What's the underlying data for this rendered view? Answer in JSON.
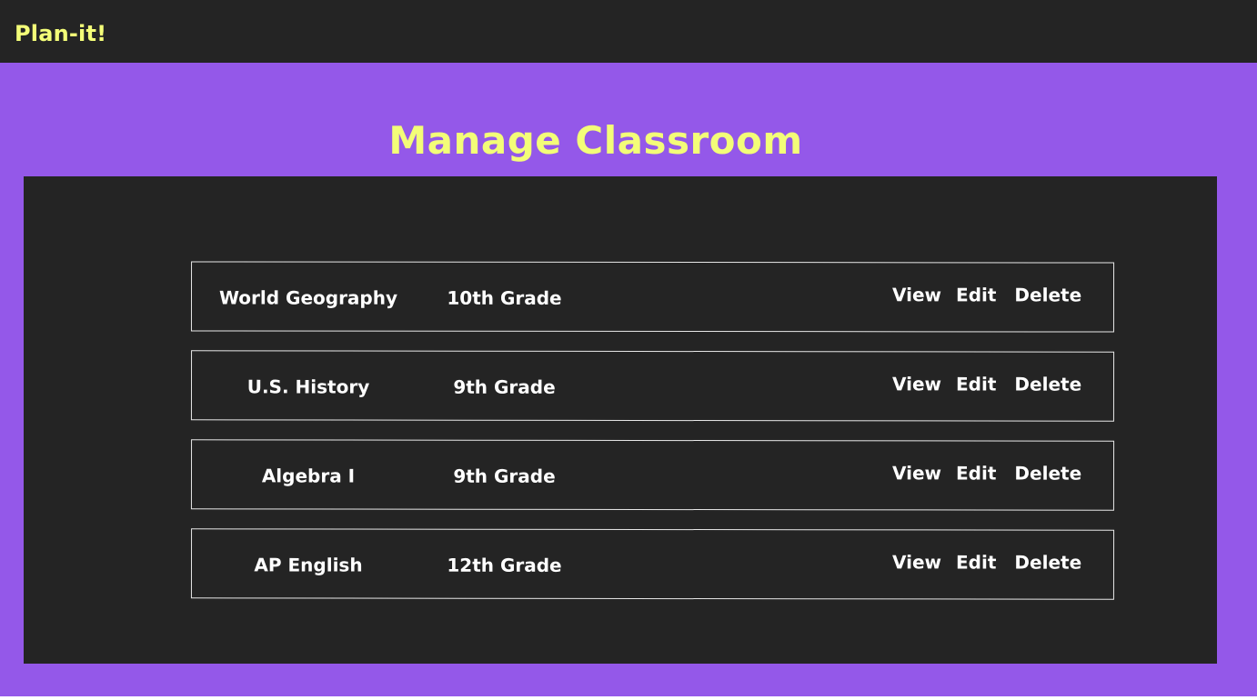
{
  "app": {
    "name": "Plan-it!"
  },
  "page": {
    "title": "Manage Classroom"
  },
  "classrooms": [
    {
      "name": "World Geography",
      "grade": "10th Grade",
      "view_label": "View",
      "edit_label": "Edit",
      "delete_label": "Delete"
    },
    {
      "name": "U.S. History",
      "grade": "9th Grade",
      "view_label": "View",
      "edit_label": "Edit",
      "delete_label": "Delete"
    },
    {
      "name": "Algebra I",
      "grade": "9th Grade",
      "view_label": "View",
      "edit_label": "Edit",
      "delete_label": "Delete"
    },
    {
      "name": "AP English",
      "grade": "12th Grade",
      "view_label": "View",
      "edit_label": "Edit",
      "delete_label": "Delete"
    }
  ],
  "colors": {
    "accent_yellow": "#f3fd78",
    "background_purple": "#9458e9",
    "panel_dark": "#242424"
  }
}
